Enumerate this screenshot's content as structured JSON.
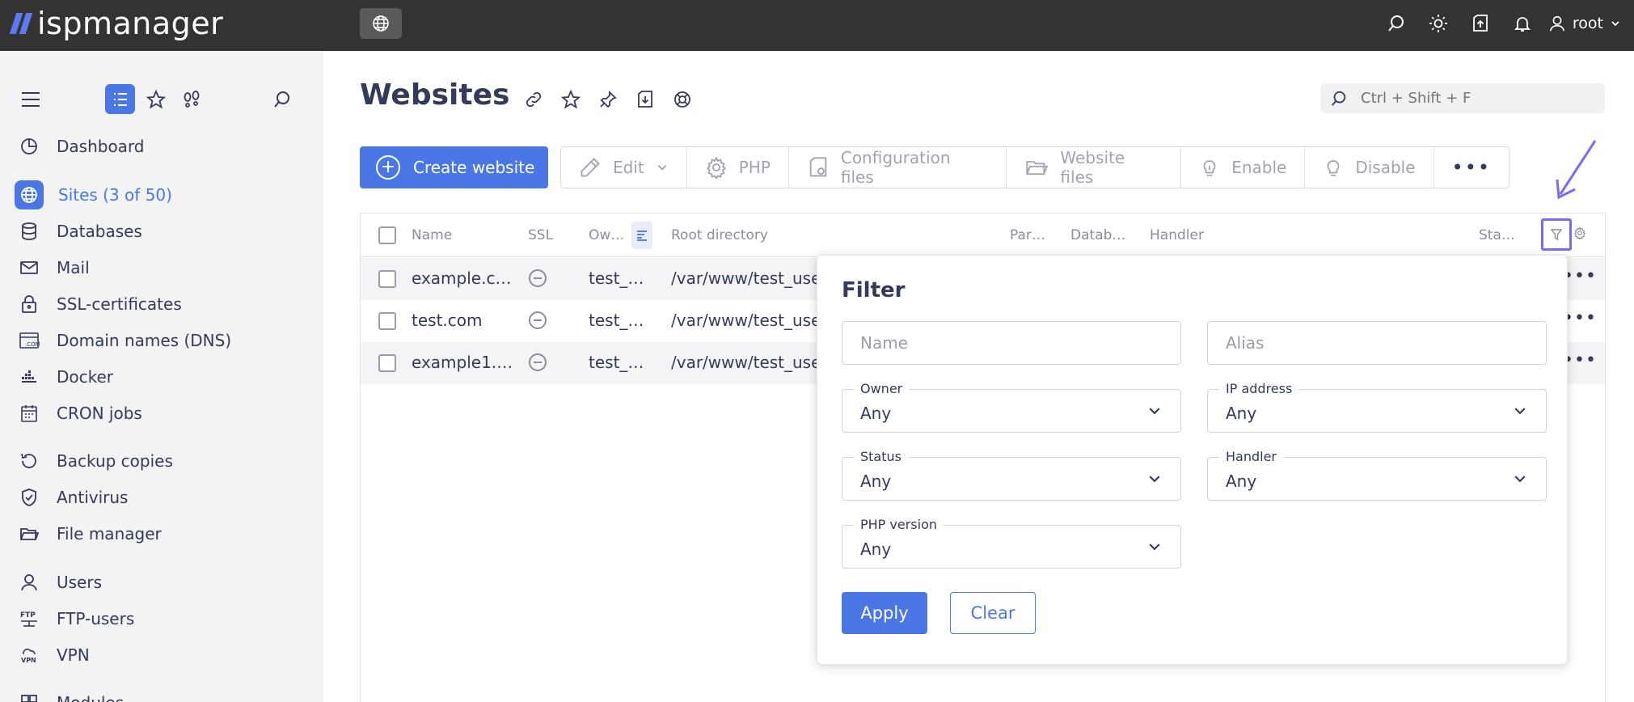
{
  "app": {
    "logo_text": "ispmanager"
  },
  "topbar": {
    "user_name": "root"
  },
  "sidebar": {
    "items": [
      {
        "label": "Dashboard",
        "icon": "dashboard-icon"
      },
      {
        "label": "Sites (3 of 50)",
        "icon": "globe-icon"
      },
      {
        "label": "Databases",
        "icon": "database-icon"
      },
      {
        "label": "Mail",
        "icon": "mail-icon"
      },
      {
        "label": "SSL-certificates",
        "icon": "lock-icon"
      },
      {
        "label": "Domain names (DNS)",
        "icon": "dns-icon"
      },
      {
        "label": "Docker",
        "icon": "docker-icon"
      },
      {
        "label": "CRON jobs",
        "icon": "calendar-icon"
      },
      {
        "label": "Backup copies",
        "icon": "backup-icon"
      },
      {
        "label": "Antivirus",
        "icon": "shield-icon"
      },
      {
        "label": "File manager",
        "icon": "folder-icon"
      },
      {
        "label": "Users",
        "icon": "user-icon"
      },
      {
        "label": "FTP-users",
        "icon": "ftp-icon"
      },
      {
        "label": "VPN",
        "icon": "vpn-icon"
      },
      {
        "label": "Modules",
        "icon": "modules-icon"
      }
    ]
  },
  "page": {
    "title": "Websites"
  },
  "search": {
    "placeholder": "Ctrl + Shift + F"
  },
  "toolbar": {
    "create_label": "Create website",
    "edit_label": "Edit",
    "php_label": "PHP",
    "config_label": "Configuration files",
    "files_label": "Website files",
    "enable_label": "Enable",
    "disable_label": "Disable"
  },
  "table": {
    "columns": {
      "name": "Name",
      "ssl": "SSL",
      "owner": "Ow…",
      "root": "Root directory",
      "parent": "Par…",
      "databases": "Datab…",
      "handler": "Handler",
      "status": "Sta…"
    },
    "rows": [
      {
        "name": "example.c…",
        "owner": "test_…",
        "root": "/var/www/test_use"
      },
      {
        "name": "test.com",
        "owner": "test_…",
        "root": "/var/www/test_use"
      },
      {
        "name": "example1.…",
        "owner": "test_…",
        "root": "/var/www/test_use"
      }
    ]
  },
  "filter": {
    "title": "Filter",
    "name_placeholder": "Name",
    "alias_placeholder": "Alias",
    "owner_label": "Owner",
    "owner_value": "Any",
    "ip_label": "IP address",
    "ip_value": "Any",
    "status_label": "Status",
    "status_value": "Any",
    "handler_label": "Handler",
    "handler_value": "Any",
    "php_label": "PHP version",
    "php_value": "Any",
    "apply_label": "Apply",
    "clear_label": "Clear"
  },
  "colors": {
    "accent": "#4a76e6",
    "topbar": "#333333",
    "sidebar": "#f3f3f3",
    "highlight": "#7a6bf0"
  }
}
